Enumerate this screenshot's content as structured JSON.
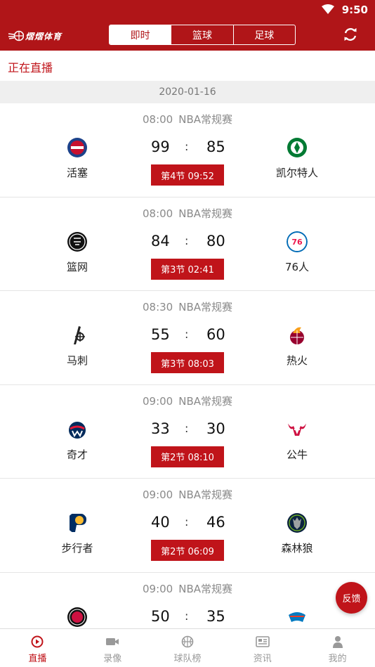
{
  "status_bar": {
    "time": "9:50"
  },
  "app": {
    "logo_text": "熠熠体育"
  },
  "segments": [
    {
      "label": "即时",
      "active": true
    },
    {
      "label": "篮球",
      "active": false
    },
    {
      "label": "足球",
      "active": false
    }
  ],
  "section_title": "正在直播",
  "date": "2020-01-16",
  "matches": [
    {
      "time": "08:00",
      "league": "NBA常规赛",
      "home": "活塞",
      "away": "凯尔特人",
      "home_score": "99",
      "away_score": "85",
      "period": "第4节 09:52",
      "home_icon": "pistons-logo-icon",
      "away_icon": "celtics-logo-icon"
    },
    {
      "time": "08:00",
      "league": "NBA常规赛",
      "home": "篮网",
      "away": "76人",
      "home_score": "84",
      "away_score": "80",
      "period": "第3节 02:41",
      "home_icon": "nets-logo-icon",
      "away_icon": "76ers-logo-icon"
    },
    {
      "time": "08:30",
      "league": "NBA常规赛",
      "home": "马刺",
      "away": "热火",
      "home_score": "55",
      "away_score": "60",
      "period": "第3节 08:03",
      "home_icon": "spurs-logo-icon",
      "away_icon": "heat-logo-icon"
    },
    {
      "time": "09:00",
      "league": "NBA常规赛",
      "home": "奇才",
      "away": "公牛",
      "home_score": "33",
      "away_score": "30",
      "period": "第2节 08:10",
      "home_icon": "wizards-logo-icon",
      "away_icon": "bulls-logo-icon"
    },
    {
      "time": "09:00",
      "league": "NBA常规赛",
      "home": "步行者",
      "away": "森林狼",
      "home_score": "40",
      "away_score": "46",
      "period": "第2节 06:09",
      "home_icon": "pacers-logo-icon",
      "away_icon": "timberwolves-logo-icon"
    },
    {
      "time": "09:00",
      "league": "NBA常规赛",
      "home": "",
      "away": "",
      "home_score": "50",
      "away_score": "35",
      "period": "",
      "home_icon": "raptors-logo-icon",
      "away_icon": "thunder-logo-icon"
    }
  ],
  "feedback_label": "反馈",
  "bottom_nav": [
    {
      "label": "直播",
      "icon": "live-play-icon",
      "active": true
    },
    {
      "label": "录像",
      "icon": "video-camera-icon",
      "active": false
    },
    {
      "label": "球队榜",
      "icon": "basketball-icon",
      "active": false
    },
    {
      "label": "资讯",
      "icon": "news-icon",
      "active": false
    },
    {
      "label": "我的",
      "icon": "user-icon",
      "active": false
    }
  ],
  "colors": {
    "brand_red": "#b01518",
    "accent_red": "#c0141a"
  }
}
